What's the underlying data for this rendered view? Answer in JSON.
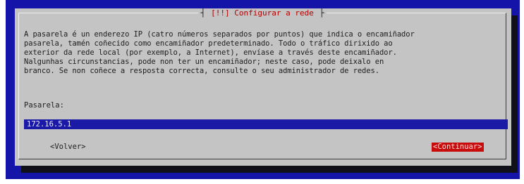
{
  "dialog": {
    "title_open": "┤",
    "title": "[!!] Configurar a rede",
    "title_close": "├",
    "message": "A pasarela é un enderezo IP (catro números separados por puntos) que indica o encamiñador\npasarela, tamén coñecido como encamiñador predeterminado. Todo o tráfico dirixido ao\nexterior da rede local (por exemplo, a Internet), envíase a través deste encamiñador.\nNalgunhas circunstancias, pode non ter un encamiñador; neste caso, pode deixalo en\nbranco. Se non coñece a resposta correcta, consulte o seu administrador de redes.",
    "field_label": "Pasarela:",
    "field_value": "172.16.5.1",
    "back_label": "<Volver>",
    "continue_label": "<Continuar>"
  },
  "colors": {
    "background": "#1414a8",
    "dialog": "#c4c4c4",
    "title": "#b40000",
    "input": "#1a1aa6",
    "selected_button": "#c80c0c"
  }
}
